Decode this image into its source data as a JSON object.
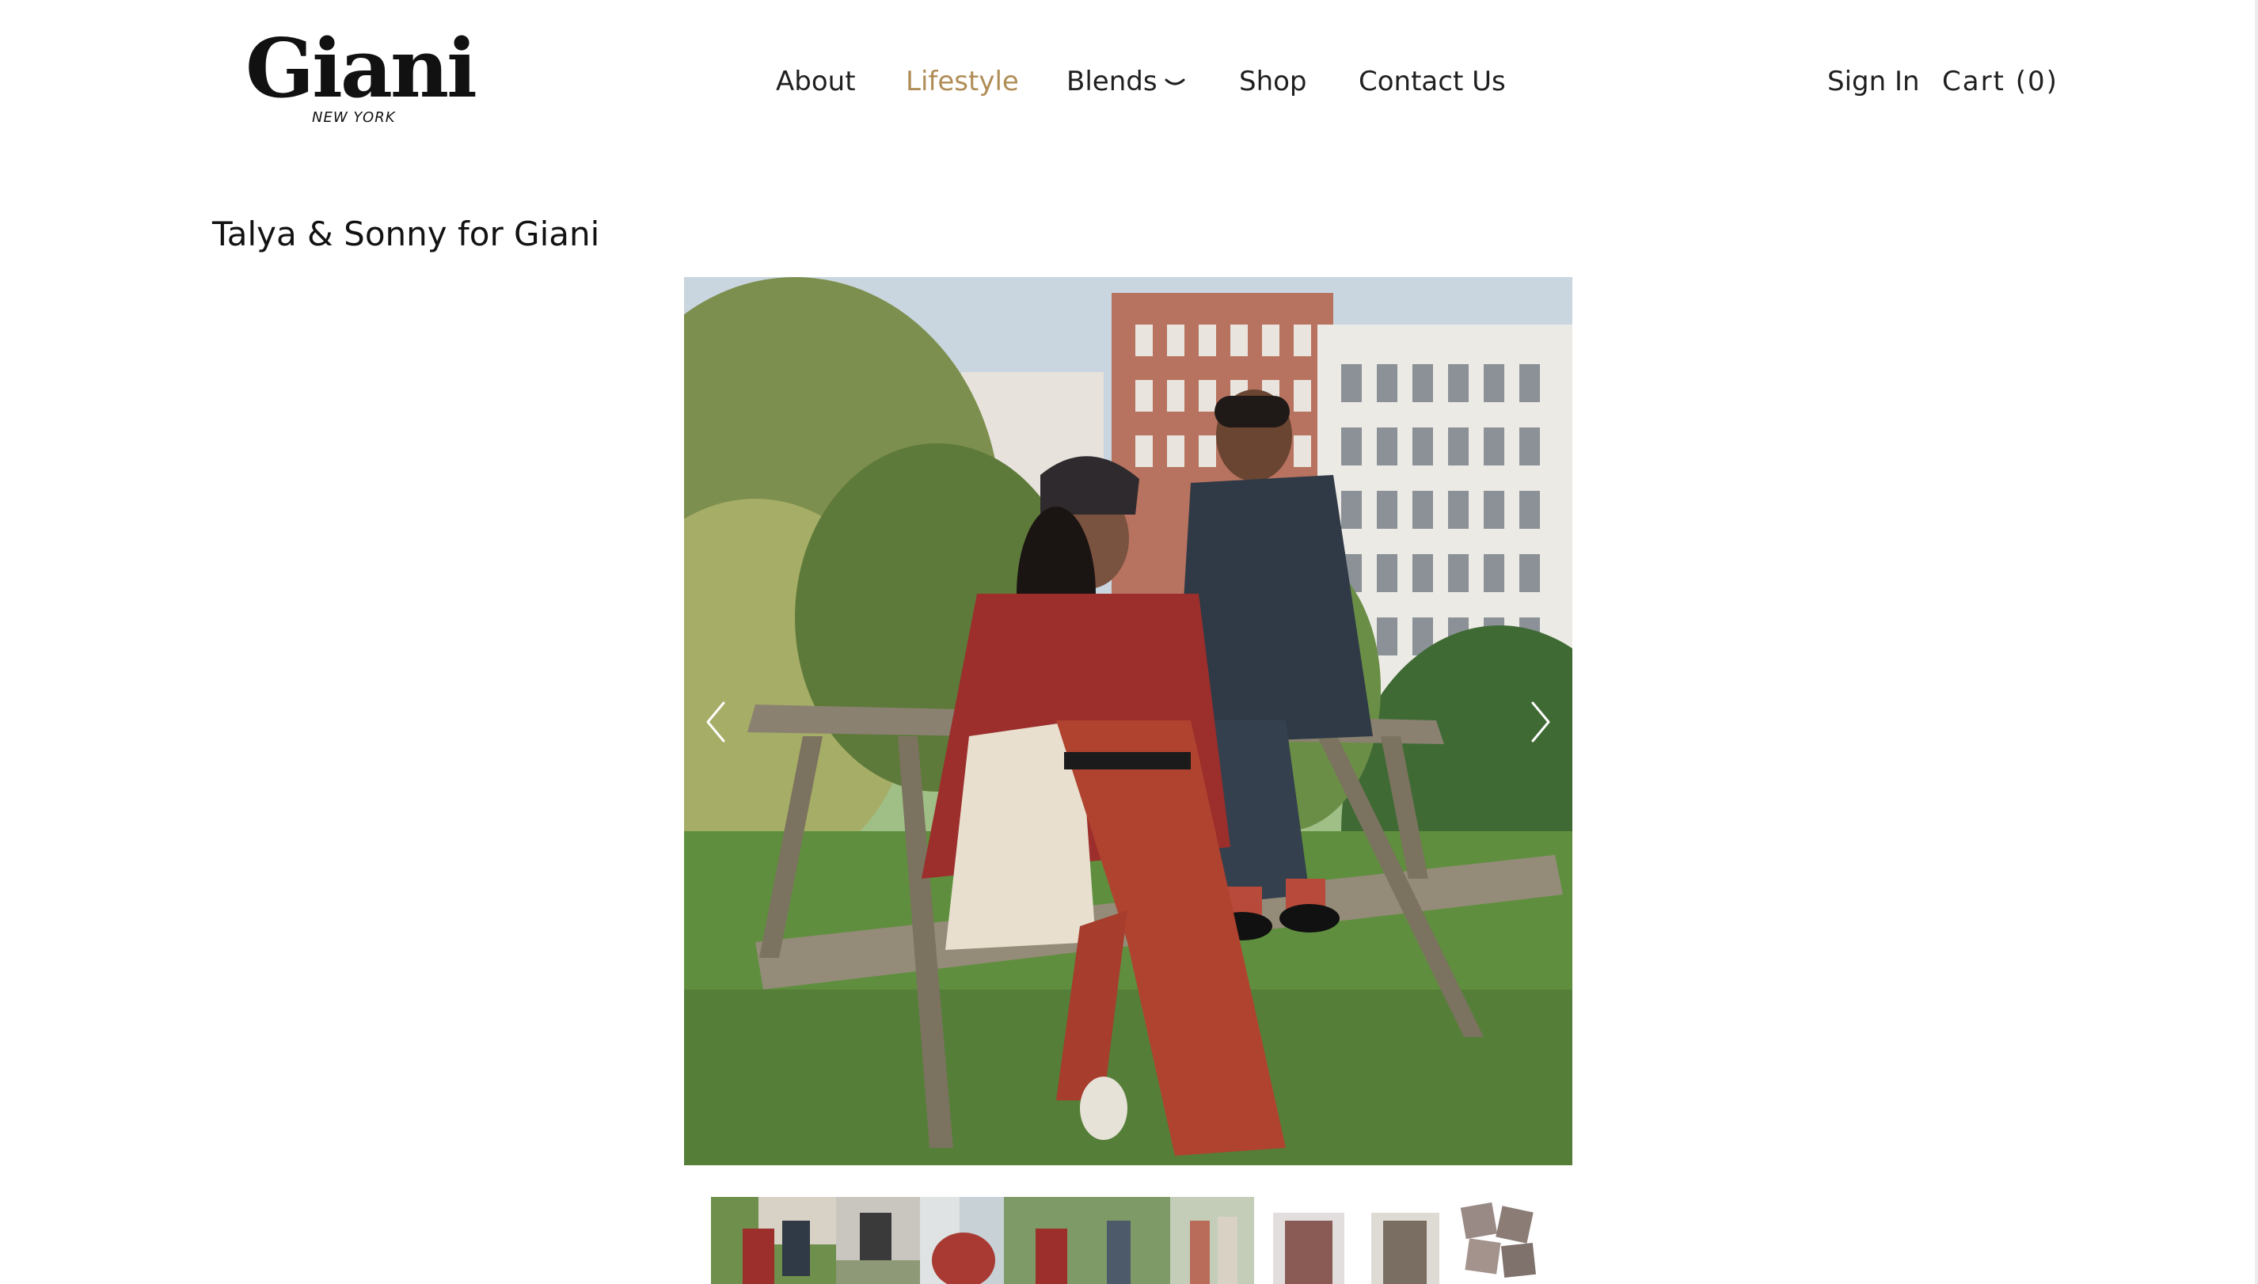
{
  "brand": {
    "logo_alt": "Giani New York",
    "wordmark": "Giani",
    "tagline": "NEW YORK"
  },
  "nav": {
    "items": [
      {
        "label": "About",
        "active": false
      },
      {
        "label": "Lifestyle",
        "active": true
      },
      {
        "label": "Blends",
        "active": false,
        "has_dropdown": true
      },
      {
        "label": "Shop",
        "active": false
      },
      {
        "label": "Contact Us",
        "active": false
      }
    ],
    "active_color": "#b08d57"
  },
  "account": {
    "sign_in": "Sign In",
    "cart": "Cart (0)"
  },
  "page": {
    "title": "Talya & Sonny for Giani"
  },
  "gallery": {
    "main_image": "photo of two women sitting on a wooden picnic table in a park with buildings behind",
    "prev_icon": "chevron-left-icon",
    "next_icon": "chevron-right-icon",
    "thumbnails": [
      "thumb-1",
      "thumb-2",
      "thumb-3",
      "thumb-4",
      "thumb-5",
      "thumb-6",
      "thumb-7",
      "thumb-8",
      "thumb-9"
    ],
    "selected_index": 0
  }
}
